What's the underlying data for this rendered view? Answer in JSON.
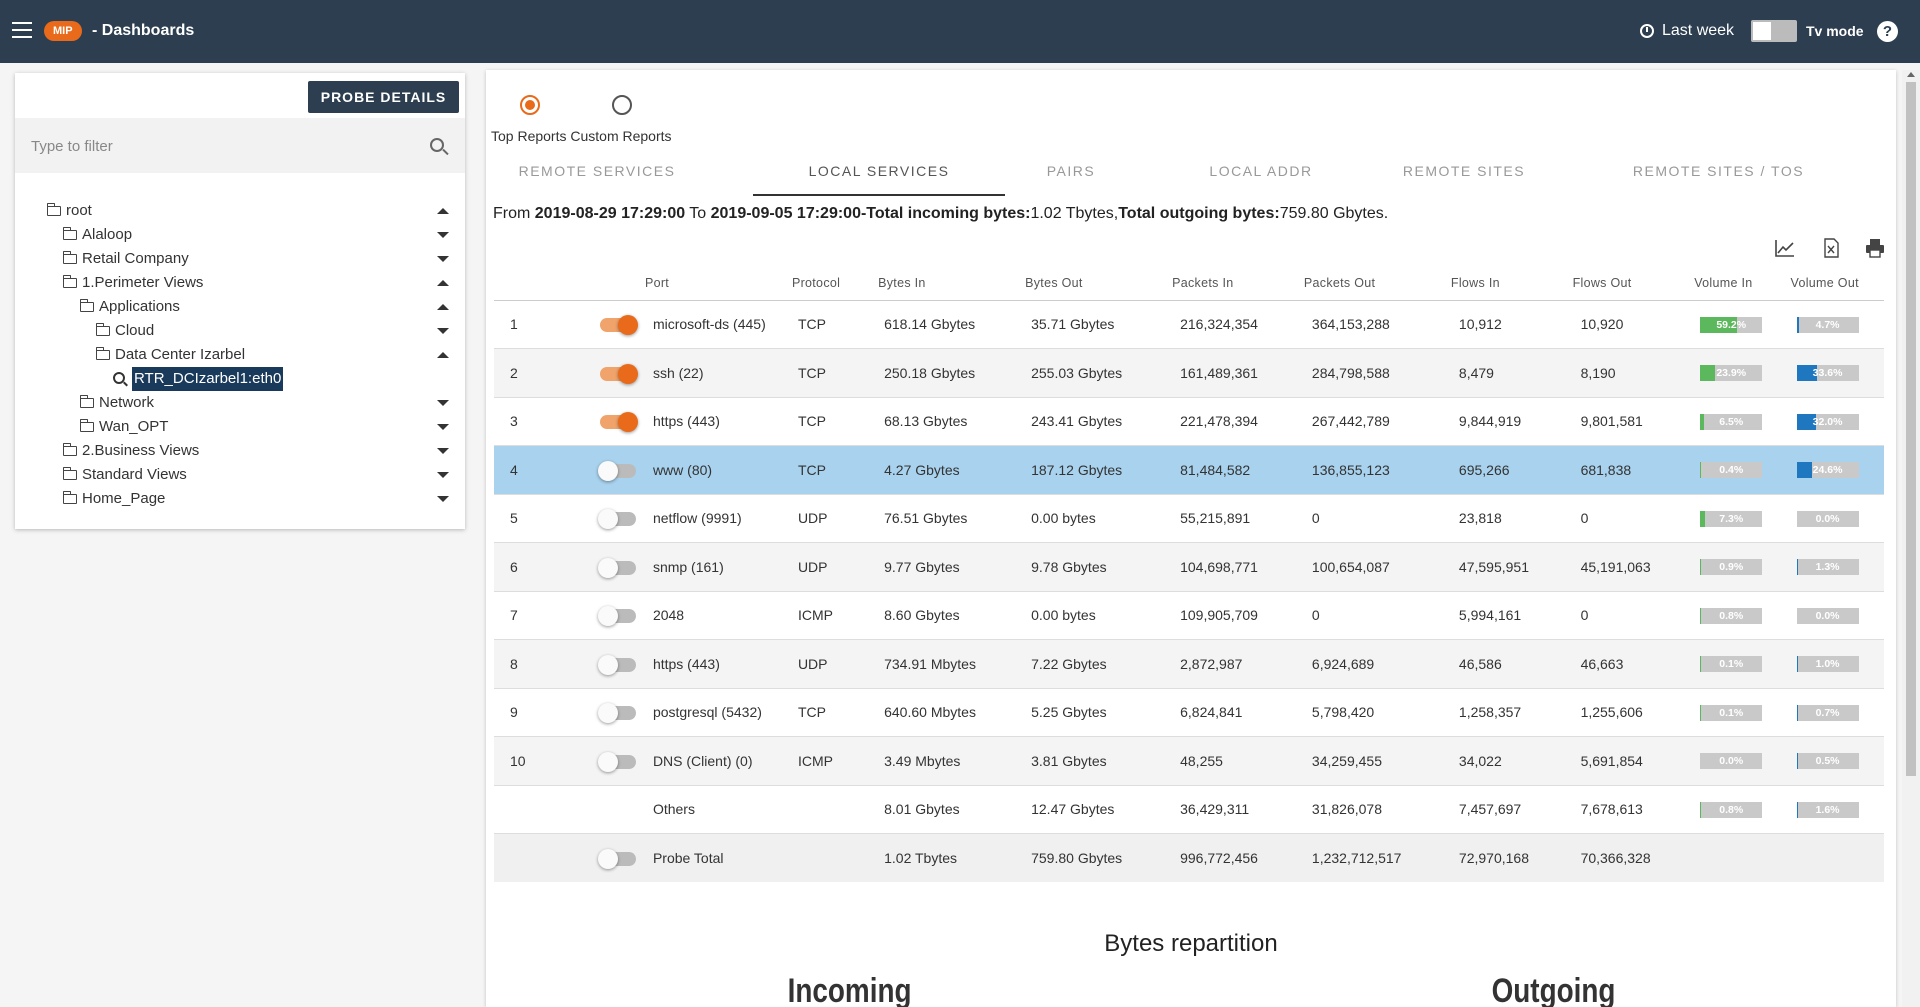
{
  "header": {
    "brand_badge": "MIP",
    "title": "- Dashboards",
    "time_range": "Last week",
    "tv_mode_label": "Tv mode",
    "help": "?"
  },
  "left": {
    "probe_button": "PROBE DETAILS",
    "filter_placeholder": "Type to filter",
    "tree": [
      {
        "label": "root",
        "level": 0,
        "icon": "folder-open-icon",
        "arrow": "up"
      },
      {
        "label": "Alaloop",
        "level": 1,
        "icon": "folder-icon",
        "arrow": "down"
      },
      {
        "label": "Retail Company",
        "level": 1,
        "icon": "folder-icon",
        "arrow": "down"
      },
      {
        "label": "1.Perimeter Views",
        "level": 1,
        "icon": "folder-open-icon",
        "arrow": "up"
      },
      {
        "label": "Applications",
        "level": 2,
        "icon": "folder-open-icon",
        "arrow": "up"
      },
      {
        "label": "Cloud",
        "level": 3,
        "icon": "folder-icon",
        "arrow": "down"
      },
      {
        "label": "Data Center Izarbel",
        "level": 3,
        "icon": "folder-open-icon",
        "arrow": "up"
      },
      {
        "label": "RTR_DCIzarbel1:eth0",
        "level": 4,
        "icon": "search-icon",
        "arrow": "",
        "selected": true
      },
      {
        "label": "Network",
        "level": 2,
        "icon": "folder-icon",
        "arrow": "down"
      },
      {
        "label": "Wan_OPT",
        "level": 2,
        "icon": "folder-icon",
        "arrow": "down"
      },
      {
        "label": "2.Business Views",
        "level": 1,
        "icon": "folder-icon",
        "arrow": "down"
      },
      {
        "label": "Standard Views",
        "level": 1,
        "icon": "folder-icon",
        "arrow": "down"
      },
      {
        "label": "Home_Page",
        "level": 1,
        "icon": "folder-icon",
        "arrow": "down"
      }
    ]
  },
  "main": {
    "radio_labels": "Top Reports Custom Reports",
    "tabs": [
      "REMOTE SERVICES",
      "LOCAL SERVICES",
      "PAIRS",
      "LOCAL ADDR",
      "REMOTE SITES",
      "REMOTE SITES / TOS"
    ],
    "active_tab": "LOCAL SERVICES",
    "summary": {
      "from_label": "From ",
      "from": "2019-08-29 17:29:00",
      "to_label": " To ",
      "to": "2019-09-05 17:29:00",
      "in_label": "-Total incoming bytes:",
      "in": "1.02 Tbytes,",
      "out_label": "Total outgoing bytes:",
      "out": "759.80 Gbytes."
    },
    "columns": [
      "Port",
      "Protocol",
      "Bytes In",
      "Bytes Out",
      "Packets In",
      "Packets Out",
      "Flows In",
      "Flows Out",
      "Volume In",
      "Volume Out"
    ],
    "rows": [
      {
        "n": "1",
        "on": true,
        "port": "microsoft-ds (445)",
        "proto": "TCP",
        "bin": "618.14 Gbytes",
        "bout": "35.71 Gbytes",
        "pin": "216,324,354",
        "pout": "364,153,288",
        "fin": "10,912",
        "fout": "10,920",
        "vin": "59.2%",
        "vout": "4.7%",
        "vin_v": 59.2,
        "vout_v": 4.7
      },
      {
        "n": "2",
        "on": true,
        "port": "ssh (22)",
        "proto": "TCP",
        "bin": "250.18 Gbytes",
        "bout": "255.03 Gbytes",
        "pin": "161,489,361",
        "pout": "284,798,588",
        "fin": "8,479",
        "fout": "8,190",
        "vin": "23.9%",
        "vout": "33.6%",
        "vin_v": 23.9,
        "vout_v": 33.6
      },
      {
        "n": "3",
        "on": true,
        "port": "https (443)",
        "proto": "TCP",
        "bin": "68.13 Gbytes",
        "bout": "243.41 Gbytes",
        "pin": "221,478,394",
        "pout": "267,442,789",
        "fin": "9,844,919",
        "fout": "9,801,581",
        "vin": "6.5%",
        "vout": "32.0%",
        "vin_v": 6.5,
        "vout_v": 32.0
      },
      {
        "n": "4",
        "on": false,
        "port": "www (80)",
        "proto": "TCP",
        "bin": "4.27 Gbytes",
        "bout": "187.12 Gbytes",
        "pin": "81,484,582",
        "pout": "136,855,123",
        "fin": "695,266",
        "fout": "681,838",
        "vin": "0.4%",
        "vout": "24.6%",
        "vin_v": 0.4,
        "vout_v": 24.6,
        "highlight": true
      },
      {
        "n": "5",
        "on": false,
        "port": "netflow (9991)",
        "proto": "UDP",
        "bin": "76.51 Gbytes",
        "bout": "0.00 bytes",
        "pin": "55,215,891",
        "pout": "0",
        "fin": "23,818",
        "fout": "0",
        "vin": "7.3%",
        "vout": "0.0%",
        "vin_v": 7.3,
        "vout_v": 0.0
      },
      {
        "n": "6",
        "on": false,
        "port": "snmp (161)",
        "proto": "UDP",
        "bin": "9.77 Gbytes",
        "bout": "9.78 Gbytes",
        "pin": "104,698,771",
        "pout": "100,654,087",
        "fin": "47,595,951",
        "fout": "45,191,063",
        "vin": "0.9%",
        "vout": "1.3%",
        "vin_v": 0.9,
        "vout_v": 1.3
      },
      {
        "n": "7",
        "on": false,
        "port": "2048",
        "proto": "ICMP",
        "bin": "8.60 Gbytes",
        "bout": "0.00 bytes",
        "pin": "109,905,709",
        "pout": "0",
        "fin": "5,994,161",
        "fout": "0",
        "vin": "0.8%",
        "vout": "0.0%",
        "vin_v": 0.8,
        "vout_v": 0.0
      },
      {
        "n": "8",
        "on": false,
        "port": "https (443)",
        "proto": "UDP",
        "bin": "734.91 Mbytes",
        "bout": "7.22 Gbytes",
        "pin": "2,872,987",
        "pout": "6,924,689",
        "fin": "46,586",
        "fout": "46,663",
        "vin": "0.1%",
        "vout": "1.0%",
        "vin_v": 0.1,
        "vout_v": 1.0
      },
      {
        "n": "9",
        "on": false,
        "port": "postgresql (5432)",
        "proto": "TCP",
        "bin": "640.60 Mbytes",
        "bout": "5.25 Gbytes",
        "pin": "6,824,841",
        "pout": "5,798,420",
        "fin": "1,258,357",
        "fout": "1,255,606",
        "vin": "0.1%",
        "vout": "0.7%",
        "vin_v": 0.1,
        "vout_v": 0.7
      },
      {
        "n": "10",
        "on": false,
        "port": "DNS (Client) (0)",
        "proto": "ICMP",
        "bin": "3.49 Mbytes",
        "bout": "3.81 Gbytes",
        "pin": "48,255",
        "pout": "34,259,455",
        "fin": "34,022",
        "fout": "5,691,854",
        "vin": "0.0%",
        "vout": "0.5%",
        "vin_v": 0.0,
        "vout_v": 0.5
      }
    ],
    "others": {
      "port": "Others",
      "bin": "8.01 Gbytes",
      "bout": "12.47 Gbytes",
      "pin": "36,429,311",
      "pout": "31,826,078",
      "fin": "7,457,697",
      "fout": "7,678,613",
      "vin": "0.8%",
      "vout": "1.6%",
      "vin_v": 0.8,
      "vout_v": 1.6
    },
    "total": {
      "port": "Probe Total",
      "bin": "1.02 Tbytes",
      "bout": "759.80 Gbytes",
      "pin": "996,772,456",
      "pout": "1,232,712,517",
      "fin": "72,970,168",
      "fout": "70,366,328"
    },
    "repartition_title": "Bytes repartition",
    "incoming_label": "Incoming",
    "outgoing_label": "Outgoing",
    "colors": {
      "volume_in": "#5cb85c",
      "volume_out": "#1f77c0",
      "accent": "#e86a1a"
    }
  }
}
